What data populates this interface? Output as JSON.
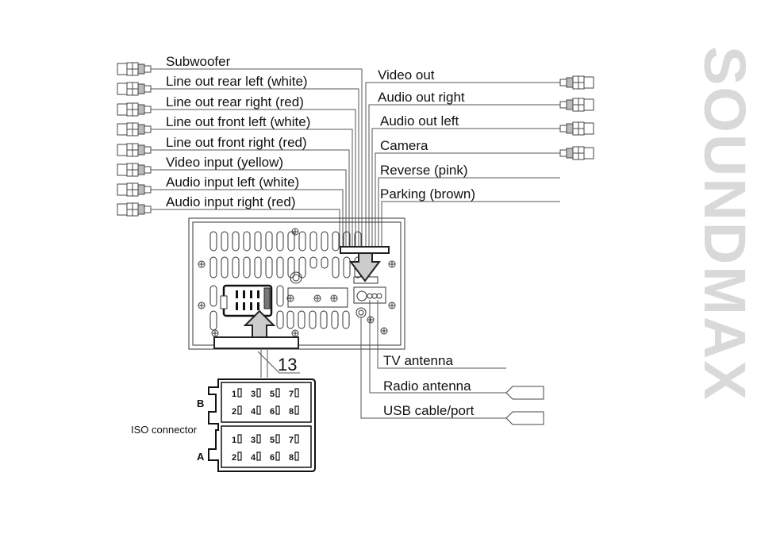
{
  "brand": "SOUNDMAX",
  "left_connectors": [
    {
      "label": "Subwoofer"
    },
    {
      "label": "Line out rear left (white)"
    },
    {
      "label": "Line out rear right (red)"
    },
    {
      "label": "Line out front left (white)"
    },
    {
      "label": "Line out front right (red)"
    },
    {
      "label": "Video input (yellow)"
    },
    {
      "label": "Audio input left (white)"
    },
    {
      "label": "Audio input right (red)"
    }
  ],
  "right_connectors": [
    {
      "label": "Video out",
      "rca": true
    },
    {
      "label": "Audio out right",
      "rca": true
    },
    {
      "label": "Audio out left",
      "rca": true
    },
    {
      "label": "Camera",
      "rca": true
    },
    {
      "label": "Reverse (pink)",
      "rca": false
    },
    {
      "label": "Parking (brown)",
      "rca": false
    }
  ],
  "bottom_connectors": [
    {
      "label": "TV antenna"
    },
    {
      "label": "Radio antenna"
    },
    {
      "label": "USB cable/port"
    }
  ],
  "harness_number": "13",
  "iso": {
    "label": "ISO connector",
    "blocks": [
      {
        "name": "B",
        "rows": [
          [
            "1",
            "3",
            "5",
            "7"
          ],
          [
            "2",
            "4",
            "6",
            "8"
          ]
        ]
      },
      {
        "name": "A",
        "rows": [
          [
            "1",
            "3",
            "5",
            "7"
          ],
          [
            "2",
            "4",
            "6",
            "8"
          ]
        ]
      }
    ]
  }
}
